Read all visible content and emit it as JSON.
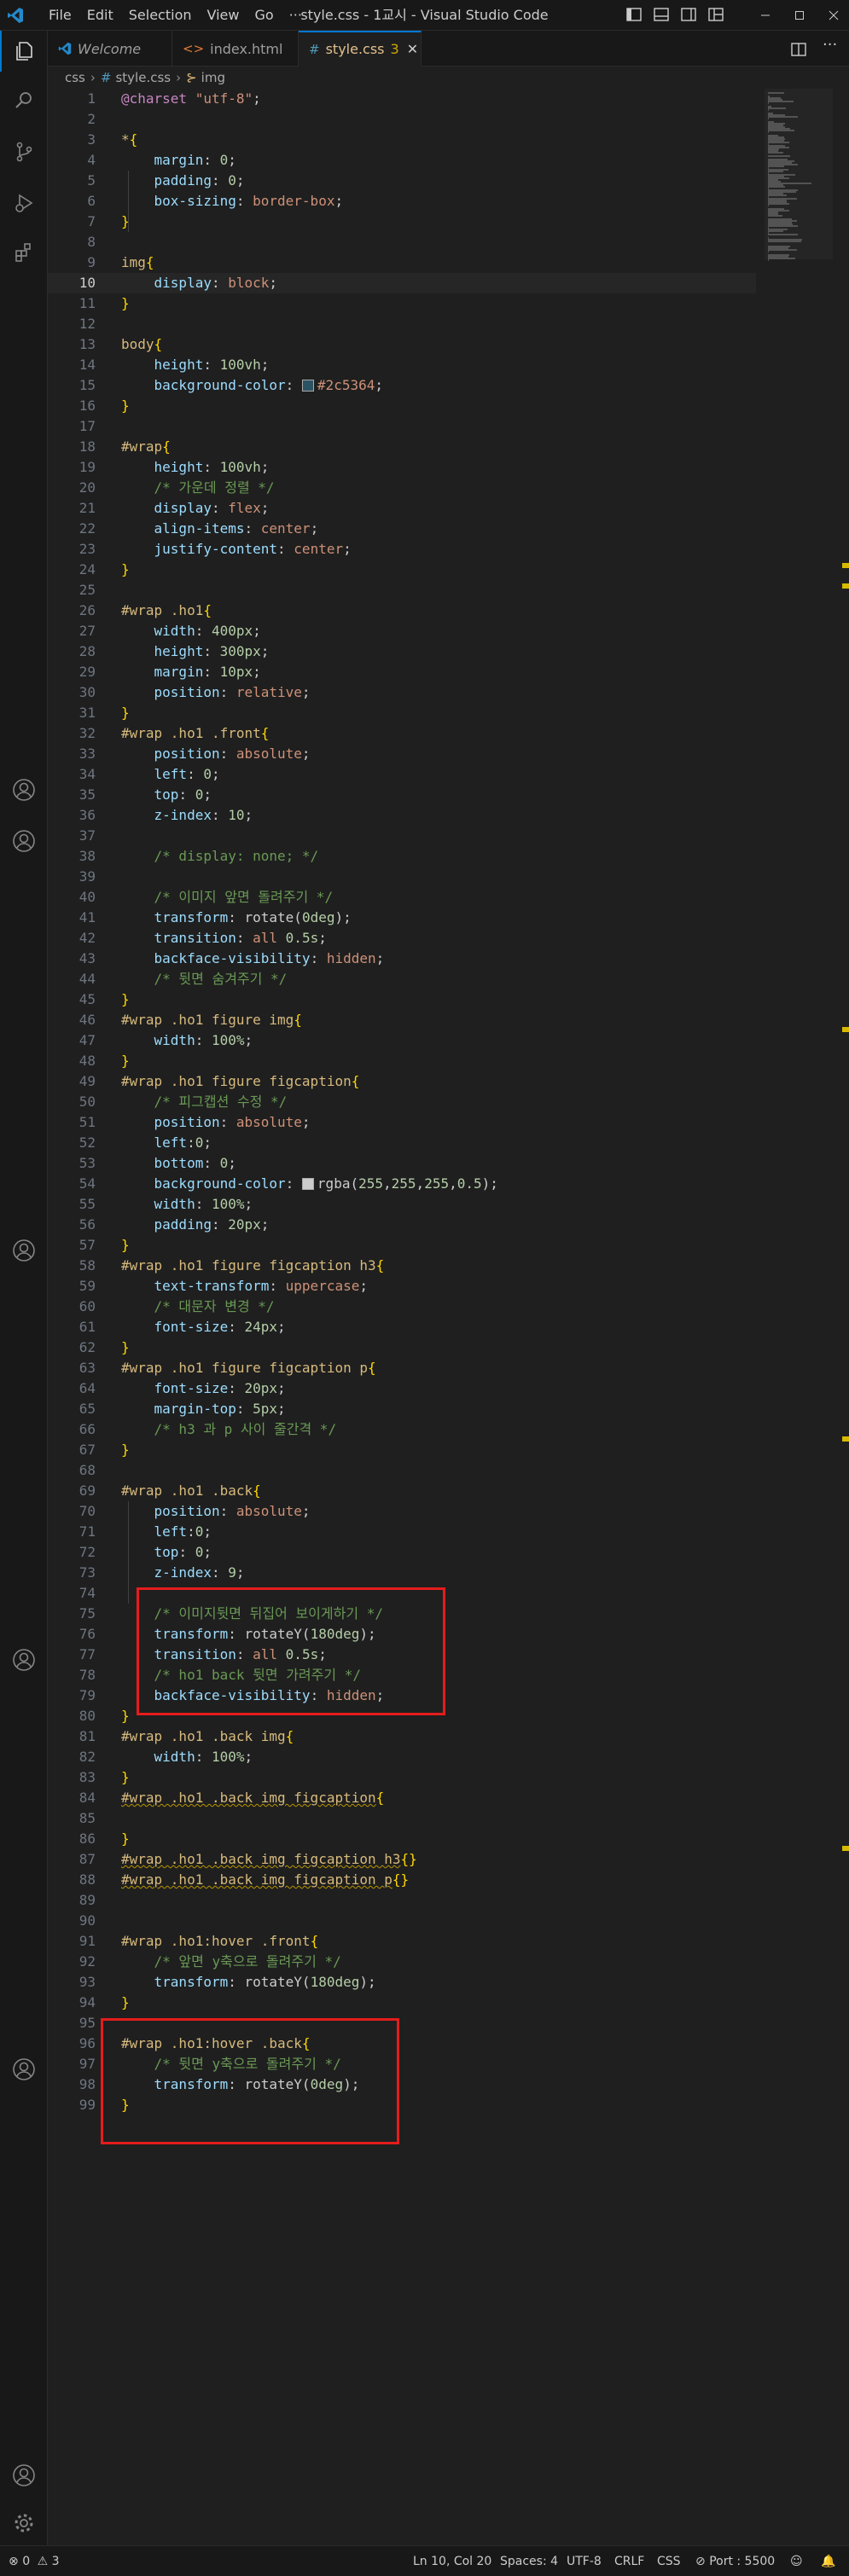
{
  "titlebar": {
    "menus": [
      "File",
      "Edit",
      "Selection",
      "View",
      "Go",
      "···"
    ],
    "title": "style.css - 1교시 - Visual Studio Code"
  },
  "tabs": [
    {
      "icon": "vscode-logo-icon",
      "label": "Welcome",
      "active": false
    },
    {
      "icon": "html-file-icon",
      "icon_glyph": "<>",
      "label": "index.html",
      "active": false
    },
    {
      "icon": "css-file-icon",
      "icon_glyph": "#",
      "label": "style.css",
      "badge": "3",
      "active": true
    }
  ],
  "breadcrumb": {
    "folder": "css",
    "file_icon": "#",
    "file": "style.css",
    "symbol_icon": "⊱",
    "symbol": "img"
  },
  "editor": {
    "current_line": 10,
    "lines": [
      [
        [
          "at",
          "@charset"
        ],
        [
          "pl",
          " "
        ],
        [
          "val",
          "\"utf-8\""
        ],
        [
          "pl",
          ";"
        ]
      ],
      [],
      [
        [
          "sel",
          "*"
        ],
        [
          "brk",
          "{"
        ]
      ],
      [
        [
          "pl",
          "    "
        ],
        [
          "prop",
          "margin"
        ],
        [
          "pl",
          ": "
        ],
        [
          "num",
          "0"
        ],
        [
          "pl",
          ";"
        ]
      ],
      [
        [
          "pl",
          "    "
        ],
        [
          "prop",
          "padding"
        ],
        [
          "pl",
          ": "
        ],
        [
          "num",
          "0"
        ],
        [
          "pl",
          ";"
        ]
      ],
      [
        [
          "pl",
          "    "
        ],
        [
          "prop",
          "box-sizing"
        ],
        [
          "pl",
          ": "
        ],
        [
          "val",
          "border-box"
        ],
        [
          "pl",
          ";"
        ]
      ],
      [
        [
          "brk",
          "}"
        ]
      ],
      [],
      [
        [
          "sel",
          "img"
        ],
        [
          "brk",
          "{"
        ]
      ],
      [
        [
          "pl",
          "    "
        ],
        [
          "prop",
          "display"
        ],
        [
          "pl",
          ": "
        ],
        [
          "val",
          "block"
        ],
        [
          "pl",
          ";"
        ]
      ],
      [
        [
          "brk",
          "}"
        ]
      ],
      [],
      [
        [
          "sel",
          "body"
        ],
        [
          "brk",
          "{"
        ]
      ],
      [
        [
          "pl",
          "    "
        ],
        [
          "prop",
          "height"
        ],
        [
          "pl",
          ": "
        ],
        [
          "num",
          "100vh"
        ],
        [
          "pl",
          ";"
        ]
      ],
      [
        [
          "pl",
          "    "
        ],
        [
          "prop",
          "background-color"
        ],
        [
          "pl",
          ": "
        ],
        [
          "swatch",
          "#2c5364"
        ],
        [
          "val",
          "#2c5364"
        ],
        [
          "pl",
          ";"
        ]
      ],
      [
        [
          "brk",
          "}"
        ]
      ],
      [],
      [
        [
          "sel",
          "#wrap"
        ],
        [
          "brk",
          "{"
        ]
      ],
      [
        [
          "pl",
          "    "
        ],
        [
          "prop",
          "height"
        ],
        [
          "pl",
          ": "
        ],
        [
          "num",
          "100vh"
        ],
        [
          "pl",
          ";"
        ]
      ],
      [
        [
          "pl",
          "    "
        ],
        [
          "cmt",
          "/* 가운데 정렬 */"
        ]
      ],
      [
        [
          "pl",
          "    "
        ],
        [
          "prop",
          "display"
        ],
        [
          "pl",
          ": "
        ],
        [
          "val",
          "flex"
        ],
        [
          "pl",
          ";"
        ]
      ],
      [
        [
          "pl",
          "    "
        ],
        [
          "prop",
          "align-items"
        ],
        [
          "pl",
          ": "
        ],
        [
          "val",
          "center"
        ],
        [
          "pl",
          ";"
        ]
      ],
      [
        [
          "pl",
          "    "
        ],
        [
          "prop",
          "justify-content"
        ],
        [
          "pl",
          ": "
        ],
        [
          "val",
          "center"
        ],
        [
          "pl",
          ";"
        ]
      ],
      [
        [
          "brk",
          "}"
        ]
      ],
      [],
      [
        [
          "sel",
          "#wrap .ho1"
        ],
        [
          "brk",
          "{"
        ]
      ],
      [
        [
          "pl",
          "    "
        ],
        [
          "prop",
          "width"
        ],
        [
          "pl",
          ": "
        ],
        [
          "num",
          "400px"
        ],
        [
          "pl",
          ";"
        ]
      ],
      [
        [
          "pl",
          "    "
        ],
        [
          "prop",
          "height"
        ],
        [
          "pl",
          ": "
        ],
        [
          "num",
          "300px"
        ],
        [
          "pl",
          ";"
        ]
      ],
      [
        [
          "pl",
          "    "
        ],
        [
          "prop",
          "margin"
        ],
        [
          "pl",
          ": "
        ],
        [
          "num",
          "10px"
        ],
        [
          "pl",
          ";"
        ]
      ],
      [
        [
          "pl",
          "    "
        ],
        [
          "prop",
          "position"
        ],
        [
          "pl",
          ": "
        ],
        [
          "val",
          "relative"
        ],
        [
          "pl",
          ";"
        ]
      ],
      [
        [
          "brk",
          "}"
        ]
      ],
      [
        [
          "sel",
          "#wrap .ho1 .front"
        ],
        [
          "brk",
          "{"
        ]
      ],
      [
        [
          "pl",
          "    "
        ],
        [
          "prop",
          "position"
        ],
        [
          "pl",
          ": "
        ],
        [
          "val",
          "absolute"
        ],
        [
          "pl",
          ";"
        ]
      ],
      [
        [
          "pl",
          "    "
        ],
        [
          "prop",
          "left"
        ],
        [
          "pl",
          ": "
        ],
        [
          "num",
          "0"
        ],
        [
          "pl",
          ";"
        ]
      ],
      [
        [
          "pl",
          "    "
        ],
        [
          "prop",
          "top"
        ],
        [
          "pl",
          ": "
        ],
        [
          "num",
          "0"
        ],
        [
          "pl",
          ";"
        ]
      ],
      [
        [
          "pl",
          "    "
        ],
        [
          "prop",
          "z-index"
        ],
        [
          "pl",
          ": "
        ],
        [
          "num",
          "10"
        ],
        [
          "pl",
          ";"
        ]
      ],
      [],
      [
        [
          "pl",
          "    "
        ],
        [
          "cmt",
          "/* display: none; */"
        ]
      ],
      [],
      [
        [
          "pl",
          "    "
        ],
        [
          "cmt",
          "/* 이미지 앞면 돌려주기 */"
        ]
      ],
      [
        [
          "pl",
          "    "
        ],
        [
          "prop",
          "transform"
        ],
        [
          "pl",
          ": rotate("
        ],
        [
          "num",
          "0deg"
        ],
        [
          "pl",
          ");"
        ]
      ],
      [
        [
          "pl",
          "    "
        ],
        [
          "prop",
          "transition"
        ],
        [
          "pl",
          ": "
        ],
        [
          "val",
          "all"
        ],
        [
          "pl",
          " "
        ],
        [
          "num",
          "0.5s"
        ],
        [
          "pl",
          ";"
        ]
      ],
      [
        [
          "pl",
          "    "
        ],
        [
          "prop",
          "backface-visibility"
        ],
        [
          "pl",
          ": "
        ],
        [
          "val",
          "hidden"
        ],
        [
          "pl",
          ";"
        ]
      ],
      [
        [
          "pl",
          "    "
        ],
        [
          "cmt",
          "/* 뒷면 숨겨주기 */"
        ]
      ],
      [
        [
          "brk",
          "}"
        ]
      ],
      [
        [
          "sel",
          "#wrap .ho1 figure img"
        ],
        [
          "brk",
          "{"
        ]
      ],
      [
        [
          "pl",
          "    "
        ],
        [
          "prop",
          "width"
        ],
        [
          "pl",
          ": "
        ],
        [
          "num",
          "100%"
        ],
        [
          "pl",
          ";"
        ]
      ],
      [
        [
          "brk",
          "}"
        ]
      ],
      [
        [
          "sel",
          "#wrap .ho1 figure figcaption"
        ],
        [
          "brk",
          "{"
        ]
      ],
      [
        [
          "pl",
          "    "
        ],
        [
          "cmt",
          "/* 피그캡션 수정 */"
        ]
      ],
      [
        [
          "pl",
          "    "
        ],
        [
          "prop",
          "position"
        ],
        [
          "pl",
          ": "
        ],
        [
          "val",
          "absolute"
        ],
        [
          "pl",
          ";"
        ]
      ],
      [
        [
          "pl",
          "    "
        ],
        [
          "prop",
          "left"
        ],
        [
          "pl",
          ":"
        ],
        [
          "num",
          "0"
        ],
        [
          "pl",
          ";"
        ]
      ],
      [
        [
          "pl",
          "    "
        ],
        [
          "prop",
          "bottom"
        ],
        [
          "pl",
          ": "
        ],
        [
          "num",
          "0"
        ],
        [
          "pl",
          ";"
        ]
      ],
      [
        [
          "pl",
          "    "
        ],
        [
          "prop",
          "background-color"
        ],
        [
          "pl",
          ": "
        ],
        [
          "swatch",
          "#cccccc"
        ],
        [
          "pl",
          "rgba("
        ],
        [
          "num",
          "255"
        ],
        [
          "pl",
          ","
        ],
        [
          "num",
          "255"
        ],
        [
          "pl",
          ","
        ],
        [
          "num",
          "255"
        ],
        [
          "pl",
          ","
        ],
        [
          "num",
          "0.5"
        ],
        [
          "pl",
          ");"
        ]
      ],
      [
        [
          "pl",
          "    "
        ],
        [
          "prop",
          "width"
        ],
        [
          "pl",
          ": "
        ],
        [
          "num",
          "100%"
        ],
        [
          "pl",
          ";"
        ]
      ],
      [
        [
          "pl",
          "    "
        ],
        [
          "prop",
          "padding"
        ],
        [
          "pl",
          ": "
        ],
        [
          "num",
          "20px"
        ],
        [
          "pl",
          ";"
        ]
      ],
      [
        [
          "brk",
          "}"
        ]
      ],
      [
        [
          "sel",
          "#wrap .ho1 figure figcaption h3"
        ],
        [
          "brk",
          "{"
        ]
      ],
      [
        [
          "pl",
          "    "
        ],
        [
          "prop",
          "text-transform"
        ],
        [
          "pl",
          ": "
        ],
        [
          "val",
          "uppercase"
        ],
        [
          "pl",
          ";"
        ]
      ],
      [
        [
          "pl",
          "    "
        ],
        [
          "cmt",
          "/* 대문자 변경 */"
        ]
      ],
      [
        [
          "pl",
          "    "
        ],
        [
          "prop",
          "font-size"
        ],
        [
          "pl",
          ": "
        ],
        [
          "num",
          "24px"
        ],
        [
          "pl",
          ";"
        ]
      ],
      [
        [
          "brk",
          "}"
        ]
      ],
      [
        [
          "sel",
          "#wrap .ho1 figure figcaption p"
        ],
        [
          "brk",
          "{"
        ]
      ],
      [
        [
          "pl",
          "    "
        ],
        [
          "prop",
          "font-size"
        ],
        [
          "pl",
          ": "
        ],
        [
          "num",
          "20px"
        ],
        [
          "pl",
          ";"
        ]
      ],
      [
        [
          "pl",
          "    "
        ],
        [
          "prop",
          "margin-top"
        ],
        [
          "pl",
          ": "
        ],
        [
          "num",
          "5px"
        ],
        [
          "pl",
          ";"
        ]
      ],
      [
        [
          "pl",
          "    "
        ],
        [
          "cmt",
          "/* h3 과 p 사이 줄간격 */"
        ]
      ],
      [
        [
          "brk",
          "}"
        ]
      ],
      [],
      [
        [
          "sel",
          "#wrap .ho1 .back"
        ],
        [
          "brk",
          "{"
        ]
      ],
      [
        [
          "pl",
          "    "
        ],
        [
          "prop",
          "position"
        ],
        [
          "pl",
          ": "
        ],
        [
          "val",
          "absolute"
        ],
        [
          "pl",
          ";"
        ]
      ],
      [
        [
          "pl",
          "    "
        ],
        [
          "prop",
          "left"
        ],
        [
          "pl",
          ":"
        ],
        [
          "num",
          "0"
        ],
        [
          "pl",
          ";"
        ]
      ],
      [
        [
          "pl",
          "    "
        ],
        [
          "prop",
          "top"
        ],
        [
          "pl",
          ": "
        ],
        [
          "num",
          "0"
        ],
        [
          "pl",
          ";"
        ]
      ],
      [
        [
          "pl",
          "    "
        ],
        [
          "prop",
          "z-index"
        ],
        [
          "pl",
          ": "
        ],
        [
          "num",
          "9"
        ],
        [
          "pl",
          ";"
        ]
      ],
      [],
      [
        [
          "pl",
          "    "
        ],
        [
          "cmt",
          "/* 이미지뒷면 뒤집어 보이게하기 */"
        ]
      ],
      [
        [
          "pl",
          "    "
        ],
        [
          "prop",
          "transform"
        ],
        [
          "pl",
          ": rotateY("
        ],
        [
          "num",
          "180deg"
        ],
        [
          "pl",
          ");"
        ]
      ],
      [
        [
          "pl",
          "    "
        ],
        [
          "prop",
          "transition"
        ],
        [
          "pl",
          ": "
        ],
        [
          "val",
          "all"
        ],
        [
          "pl",
          " "
        ],
        [
          "num",
          "0.5s"
        ],
        [
          "pl",
          ";"
        ]
      ],
      [
        [
          "pl",
          "    "
        ],
        [
          "cmt",
          "/* ho1 back 뒷면 가려주기 */"
        ]
      ],
      [
        [
          "pl",
          "    "
        ],
        [
          "prop",
          "backface-visibility"
        ],
        [
          "pl",
          ": "
        ],
        [
          "val",
          "hidden"
        ],
        [
          "pl",
          ";"
        ]
      ],
      [
        [
          "brk",
          "}"
        ]
      ],
      [
        [
          "sel",
          "#wrap .ho1 .back img"
        ],
        [
          "brk",
          "{"
        ]
      ],
      [
        [
          "pl",
          "    "
        ],
        [
          "prop",
          "width"
        ],
        [
          "pl",
          ": "
        ],
        [
          "num",
          "100%"
        ],
        [
          "pl",
          ";"
        ]
      ],
      [
        [
          "brk",
          "}"
        ]
      ],
      [
        [
          "sqsel",
          "#wrap .ho1 .back img figcaption"
        ],
        [
          "brk",
          "{"
        ]
      ],
      [],
      [
        [
          "brk",
          "}"
        ]
      ],
      [
        [
          "sqsel",
          "#wrap .ho1 .back img figcaption h3"
        ],
        [
          "brk",
          "{}"
        ]
      ],
      [
        [
          "sqsel",
          "#wrap .ho1 .back img figcaption p"
        ],
        [
          "brk",
          "{}"
        ]
      ],
      [],
      [],
      [
        [
          "sel",
          "#wrap .ho1:hover .front"
        ],
        [
          "brk",
          "{"
        ]
      ],
      [
        [
          "pl",
          "    "
        ],
        [
          "cmt",
          "/* 앞면 y축으로 돌려주기 */"
        ]
      ],
      [
        [
          "pl",
          "    "
        ],
        [
          "prop",
          "transform"
        ],
        [
          "pl",
          ": rotateY("
        ],
        [
          "num",
          "180deg"
        ],
        [
          "pl",
          ");"
        ]
      ],
      [
        [
          "brk",
          "}"
        ]
      ],
      [],
      [
        [
          "sel",
          "#wrap .ho1:hover .back"
        ],
        [
          "brk",
          "{"
        ]
      ],
      [
        [
          "pl",
          "    "
        ],
        [
          "cmt",
          "/* 뒷면 y축으로 돌려주기 */"
        ]
      ],
      [
        [
          "pl",
          "    "
        ],
        [
          "prop",
          "transform"
        ],
        [
          "pl",
          ": rotateY("
        ],
        [
          "num",
          "0deg"
        ],
        [
          "pl",
          ");"
        ]
      ],
      [
        [
          "brk",
          "}"
        ]
      ]
    ]
  },
  "statusbar": {
    "errors": "0",
    "warnings": "3",
    "position": "Ln 10, Col 20",
    "spaces": "Spaces: 4",
    "encoding": "UTF-8",
    "eol": "CRLF",
    "language": "CSS",
    "port": "Port : 5500"
  },
  "colors": {
    "accent": "#0078d4",
    "annotation_box": "#e51c1c",
    "warning": "#cca700"
  }
}
